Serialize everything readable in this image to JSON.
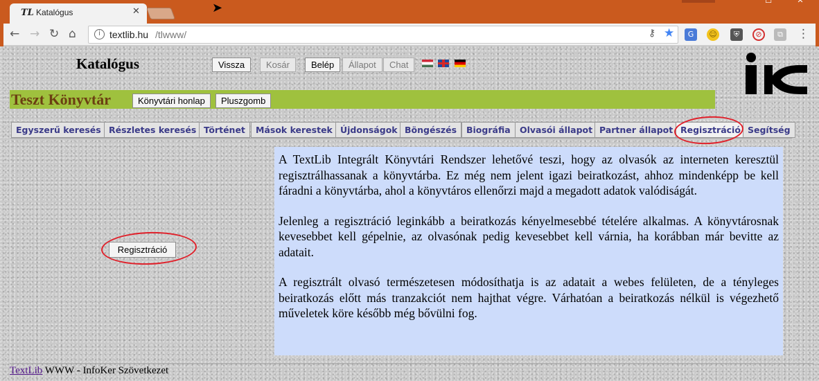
{
  "browser": {
    "tab_title": "Katalógus",
    "tab_favicon": "TL",
    "url_host": "textlib.hu",
    "url_path": "/tlwww/"
  },
  "header": {
    "title": "Katalógus",
    "buttons": [
      {
        "label": "Vissza",
        "enabled": true
      },
      {
        "label": "Kosár",
        "enabled": false
      },
      {
        "label": "Belép",
        "enabled": true
      },
      {
        "label": "Állapot",
        "enabled": false
      },
      {
        "label": "Chat",
        "enabled": false
      }
    ],
    "flags": [
      "hungarian-flag-icon",
      "english-flag-icon",
      "german-flag-icon"
    ]
  },
  "library": {
    "name": "Teszt Könyvtár",
    "buttons": [
      "Könyvtári honlap",
      "Pluszgomb"
    ]
  },
  "tabs": [
    "Egyszerű keresés",
    "Részletes keresés",
    "Történet",
    "Mások kerestek",
    "Újdonságok",
    "Böngészés",
    "Biográfia",
    "Olvasói állapot",
    "Partner állapot",
    "Regisztráció",
    "Segítség"
  ],
  "active_tab": "Regisztráció",
  "main": {
    "register_button": "Regisztráció",
    "paragraphs": [
      "A TextLib Integrált Könyvtári Rendszer lehetővé teszi, hogy az olvasók az interneten keresztül regisztrálhassanak a könyvtárba. Ez még nem jelent igazi beiratkozást, ahhoz mindenképp be kell fáradni a könyvtárba, ahol a könyvtáros ellenőrzi majd a megadott adatok valódiságát.",
      "Jelenleg a regisztráció leginkább a beiratkozás kényelmesebbé tételére alkalmas. A könyvtárosnak kevesebbet kell gépelnie, az olvasónak pedig kevesebbet kell várnia, ha korábban már bevitte az adatait.",
      "A regisztrált olvasó természetesen módosíthatja is az adatait a webes felületen, de a tényleges beiratkozás előtt más tranzakciót nem hajthat végre. Várhatóan a beiratkozás nélkül is végezhető műveletek köre később még bővülni fog."
    ]
  },
  "footer": {
    "link": "TextLib",
    "text": " WWW - InfoKer Szövetkezet"
  },
  "colors": {
    "titlebar": "#ca5a1e",
    "library_bar": "#9fc13e",
    "library_name": "#6b3f12",
    "tab_text": "#3a3a88",
    "info_background": "#cddcfb",
    "annotation": "#e0202a"
  }
}
